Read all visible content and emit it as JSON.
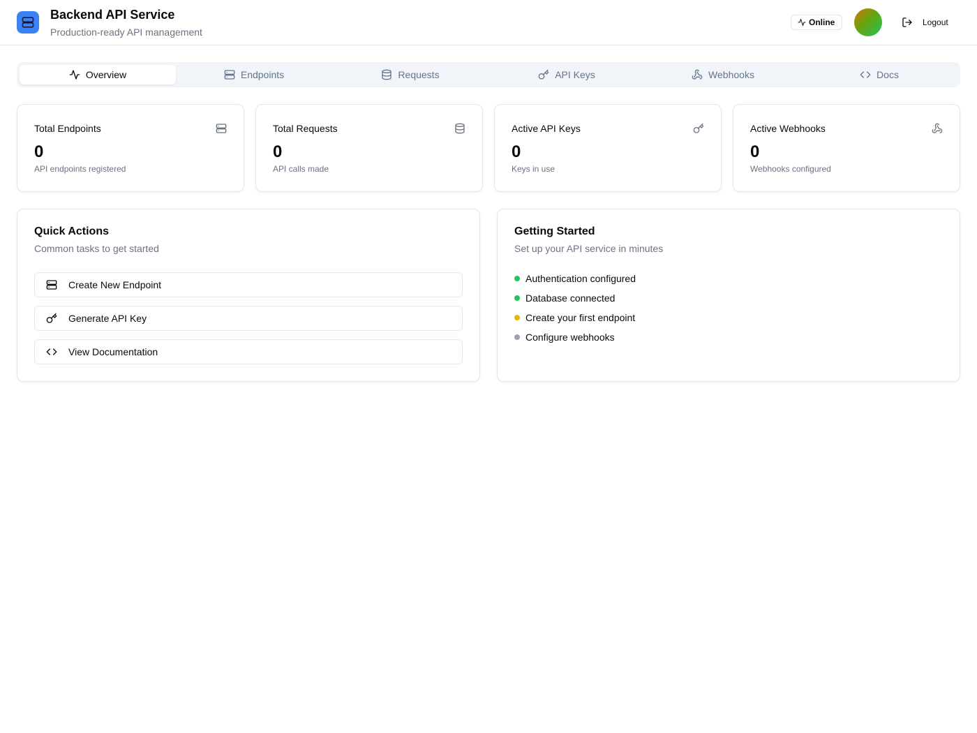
{
  "header": {
    "title": "Backend API Service",
    "subtitle": "Production-ready API management",
    "status_label": "Online",
    "logout_label": "Logout",
    "accent_color": "#3b82f6"
  },
  "tabs": [
    {
      "label": "Overview",
      "icon": "activity-icon",
      "active": true
    },
    {
      "label": "Endpoints",
      "icon": "server-icon",
      "active": false
    },
    {
      "label": "Requests",
      "icon": "database-icon",
      "active": false
    },
    {
      "label": "API Keys",
      "icon": "key-icon",
      "active": false
    },
    {
      "label": "Webhooks",
      "icon": "webhook-icon",
      "active": false
    },
    {
      "label": "Docs",
      "icon": "code-icon",
      "active": false
    }
  ],
  "stats": [
    {
      "title": "Total Endpoints",
      "value": "0",
      "caption": "API endpoints registered",
      "icon": "server-icon"
    },
    {
      "title": "Total Requests",
      "value": "0",
      "caption": "API calls made",
      "icon": "database-icon"
    },
    {
      "title": "Active API Keys",
      "value": "0",
      "caption": "Keys in use",
      "icon": "key-icon"
    },
    {
      "title": "Active Webhooks",
      "value": "0",
      "caption": "Webhooks configured",
      "icon": "webhook-icon"
    }
  ],
  "quick_actions": {
    "title": "Quick Actions",
    "subtitle": "Common tasks to get started",
    "items": [
      {
        "label": "Create New Endpoint",
        "icon": "server-icon"
      },
      {
        "label": "Generate API Key",
        "icon": "key-icon"
      },
      {
        "label": "View Documentation",
        "icon": "code-icon"
      }
    ]
  },
  "getting_started": {
    "title": "Getting Started",
    "subtitle": "Set up your API service in minutes",
    "items": [
      {
        "label": "Authentication configured",
        "status": "done",
        "color": "#22c55e"
      },
      {
        "label": "Database connected",
        "status": "done",
        "color": "#22c55e"
      },
      {
        "label": "Create your first endpoint",
        "status": "pending",
        "color": "#eab308"
      },
      {
        "label": "Configure webhooks",
        "status": "todo",
        "color": "#9ca3af"
      }
    ]
  }
}
